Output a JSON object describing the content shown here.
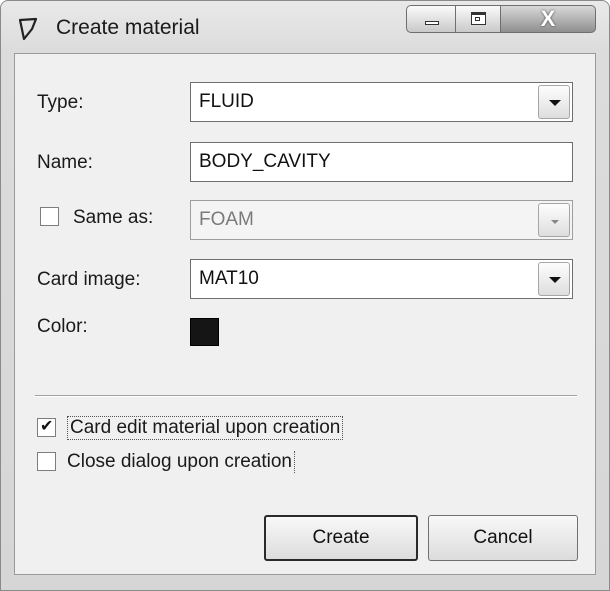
{
  "window": {
    "title": "Create material"
  },
  "icons": {
    "app": "material-icon",
    "minimize": "minimize-icon",
    "maximize": "maximize-icon",
    "close": "close-icon",
    "dropdown": "chevron-down-icon",
    "check": "checkmark-icon"
  },
  "form": {
    "type": {
      "label": "Type:",
      "value": "FLUID"
    },
    "name": {
      "label": "Name:",
      "value": "BODY_CAVITY"
    },
    "same_as": {
      "label": "Same as:",
      "checked": false,
      "value": "FOAM"
    },
    "card_image": {
      "label": "Card image:",
      "value": "MAT10"
    },
    "color": {
      "label": "Color:",
      "swatch": "#151515"
    }
  },
  "options": {
    "card_edit": {
      "label": "Card edit material upon creation",
      "checked": true
    },
    "close_dialog": {
      "label": "Close dialog upon creation",
      "checked": false
    }
  },
  "buttons": {
    "create": "Create",
    "cancel": "Cancel"
  },
  "close_glyph": "X"
}
